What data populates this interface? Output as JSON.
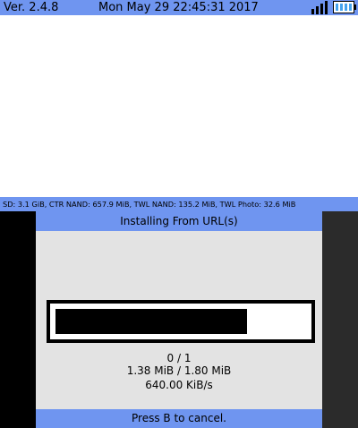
{
  "top_bar": {
    "version": "Ver. 2.4.8",
    "datetime": "Mon May 29 22:45:31 2017",
    "signal_icon": "wifi-signal-bars-icon",
    "battery_icon": "battery-full-icon"
  },
  "info_strip": {
    "text": "SD: 3.1 GiB, CTR NAND: 657.9 MiB, TWL NAND: 135.2 MiB, TWL Photo: 32.6 MiB"
  },
  "dialog": {
    "title": "Installing From URL(s)",
    "progress_fraction": 0.765,
    "item_count": "0 / 1",
    "size_progress": "1.38 MiB / 1.80 MiB",
    "speed": "640.00 KiB/s",
    "footer": "Press B to cancel."
  },
  "colors": {
    "accent_blue": "#6f95f0",
    "panel_gray": "#e3e3e3",
    "battery_blue": "#45a3ee"
  }
}
